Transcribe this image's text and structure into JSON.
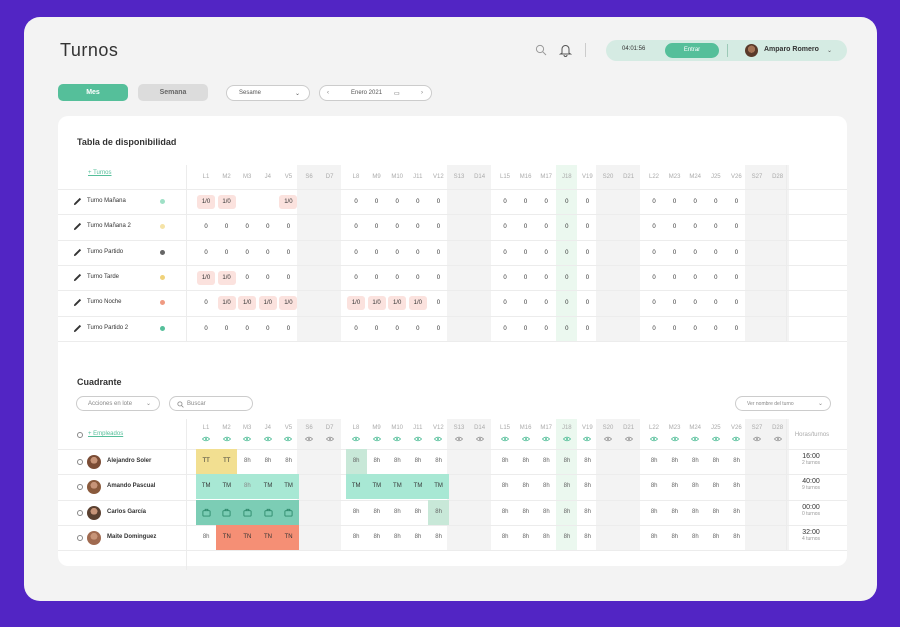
{
  "header": {
    "title": "Turnos",
    "clock": "04:01:56",
    "enter_label": "Entrar",
    "user_name": "Amparo Romero"
  },
  "toolbar": {
    "tab_month": "Mes",
    "tab_week": "Semana",
    "company_select": "Sesame",
    "month_label": "Enero 2021"
  },
  "availability": {
    "title": "Tabla de disponibilidad",
    "add_link": "+ Turnos",
    "rows": [
      {
        "name": "Turno Mañana",
        "color": "#9fe0c6",
        "values": [
          "1/0",
          "1/0",
          "",
          "",
          "1/0",
          "",
          "",
          "0",
          "0",
          "0",
          "0",
          "0",
          "",
          "",
          "0",
          "0",
          "0",
          "0",
          "0",
          "",
          "",
          "0",
          "0",
          "0",
          "0",
          "0",
          "",
          ""
        ]
      },
      {
        "name": "Turno Mañana 2",
        "color": "#f5e3a7",
        "values": [
          "0",
          "0",
          "0",
          "0",
          "0",
          "",
          "",
          "0",
          "0",
          "0",
          "0",
          "0",
          "",
          "",
          "0",
          "0",
          "0",
          "0",
          "0",
          "",
          "",
          "0",
          "0",
          "0",
          "0",
          "0",
          "",
          ""
        ]
      },
      {
        "name": "Turno Partido",
        "color": "#666666",
        "values": [
          "0",
          "0",
          "0",
          "0",
          "0",
          "",
          "",
          "0",
          "0",
          "0",
          "0",
          "0",
          "",
          "",
          "0",
          "0",
          "0",
          "0",
          "0",
          "",
          "",
          "0",
          "0",
          "0",
          "0",
          "0",
          "",
          ""
        ]
      },
      {
        "name": "Turno Tarde",
        "color": "#f0d27a",
        "values": [
          "1/0",
          "1/0",
          "0",
          "0",
          "0",
          "",
          "",
          "0",
          "0",
          "0",
          "0",
          "0",
          "",
          "",
          "0",
          "0",
          "0",
          "0",
          "0",
          "",
          "",
          "0",
          "0",
          "0",
          "0",
          "0",
          "",
          ""
        ]
      },
      {
        "name": "Turno Noche",
        "color": "#ef9a82",
        "values": [
          "0",
          "1/0",
          "1/0",
          "1/0",
          "1/0",
          "",
          "",
          "1/0",
          "1/0",
          "1/0",
          "1/0",
          "0",
          "",
          "",
          "0",
          "0",
          "0",
          "0",
          "0",
          "",
          "",
          "0",
          "0",
          "0",
          "0",
          "0",
          "",
          ""
        ]
      },
      {
        "name": "Turno Partido 2",
        "color": "#55bf9a",
        "values": [
          "0",
          "0",
          "0",
          "0",
          "0",
          "",
          "",
          "0",
          "0",
          "0",
          "0",
          "0",
          "",
          "",
          "0",
          "0",
          "0",
          "0",
          "0",
          "",
          "",
          "0",
          "0",
          "0",
          "0",
          "0",
          "",
          ""
        ]
      }
    ]
  },
  "days": [
    "L1",
    "M2",
    "M3",
    "J4",
    "V5",
    "S6",
    "D7",
    "L8",
    "M9",
    "M10",
    "J11",
    "V12",
    "S13",
    "D14",
    "L15",
    "M16",
    "M17",
    "J18",
    "V19",
    "S20",
    "D21",
    "L22",
    "M23",
    "M24",
    "J25",
    "V26",
    "S27",
    "D28"
  ],
  "roster": {
    "title": "Cuadrante",
    "bulk_actions": "Acciones en lote",
    "search_placeholder": "Buscar",
    "view_select": "Ver nombre del turno",
    "add_link": "+ Empleados",
    "hours_header": "Horas/turnos",
    "employees": [
      {
        "name": "Alejandro Soler",
        "hours": "16:00",
        "shifts": "2 turnos",
        "cells": [
          "TT",
          "TT",
          "8h",
          "8h",
          "8h",
          "",
          "",
          "8h",
          "8h",
          "8h",
          "8h",
          "8h",
          "",
          "",
          "8h",
          "8h",
          "8h",
          "8h",
          "8h",
          "",
          "",
          "8h",
          "8h",
          "8h",
          "8h",
          "8h",
          "",
          ""
        ]
      },
      {
        "name": "Amando Pascual",
        "hours": "40:00",
        "shifts": "9 turnos",
        "cells": [
          "TM",
          "TM",
          "8h",
          "TM",
          "TM",
          "",
          "",
          "TM",
          "TM",
          "TM",
          "TM",
          "TM",
          "",
          "",
          "8h",
          "8h",
          "8h",
          "8h",
          "8h",
          "",
          "",
          "8h",
          "8h",
          "8h",
          "8h",
          "8h",
          "",
          ""
        ]
      },
      {
        "name": "Carlos García",
        "hours": "00:00",
        "shifts": "0 turnos",
        "cells": [
          "",
          "",
          "",
          "",
          "",
          "",
          "",
          "8h",
          "8h",
          "8h",
          "8h",
          "8h",
          "",
          "",
          "8h",
          "8h",
          "8h",
          "8h",
          "8h",
          "",
          "",
          "8h",
          "8h",
          "8h",
          "8h",
          "8h",
          "",
          ""
        ]
      },
      {
        "name": "Maite Dominguez",
        "hours": "32:00",
        "shifts": "4 turnos",
        "cells": [
          "8h",
          "TN",
          "TN",
          "TN",
          "TN",
          "",
          "",
          "8h",
          "8h",
          "8h",
          "8h",
          "8h",
          "",
          "",
          "8h",
          "8h",
          "8h",
          "8h",
          "8h",
          "",
          "",
          "8h",
          "8h",
          "8h",
          "8h",
          "8h",
          "",
          ""
        ]
      }
    ]
  },
  "colors": {
    "accent": "#55bf9a",
    "tt": "#f2df91",
    "tm": "#a8e8d4",
    "tn": "#f58f75",
    "vacation": "#7ccdb5",
    "highlight": "#c8e8d8"
  }
}
